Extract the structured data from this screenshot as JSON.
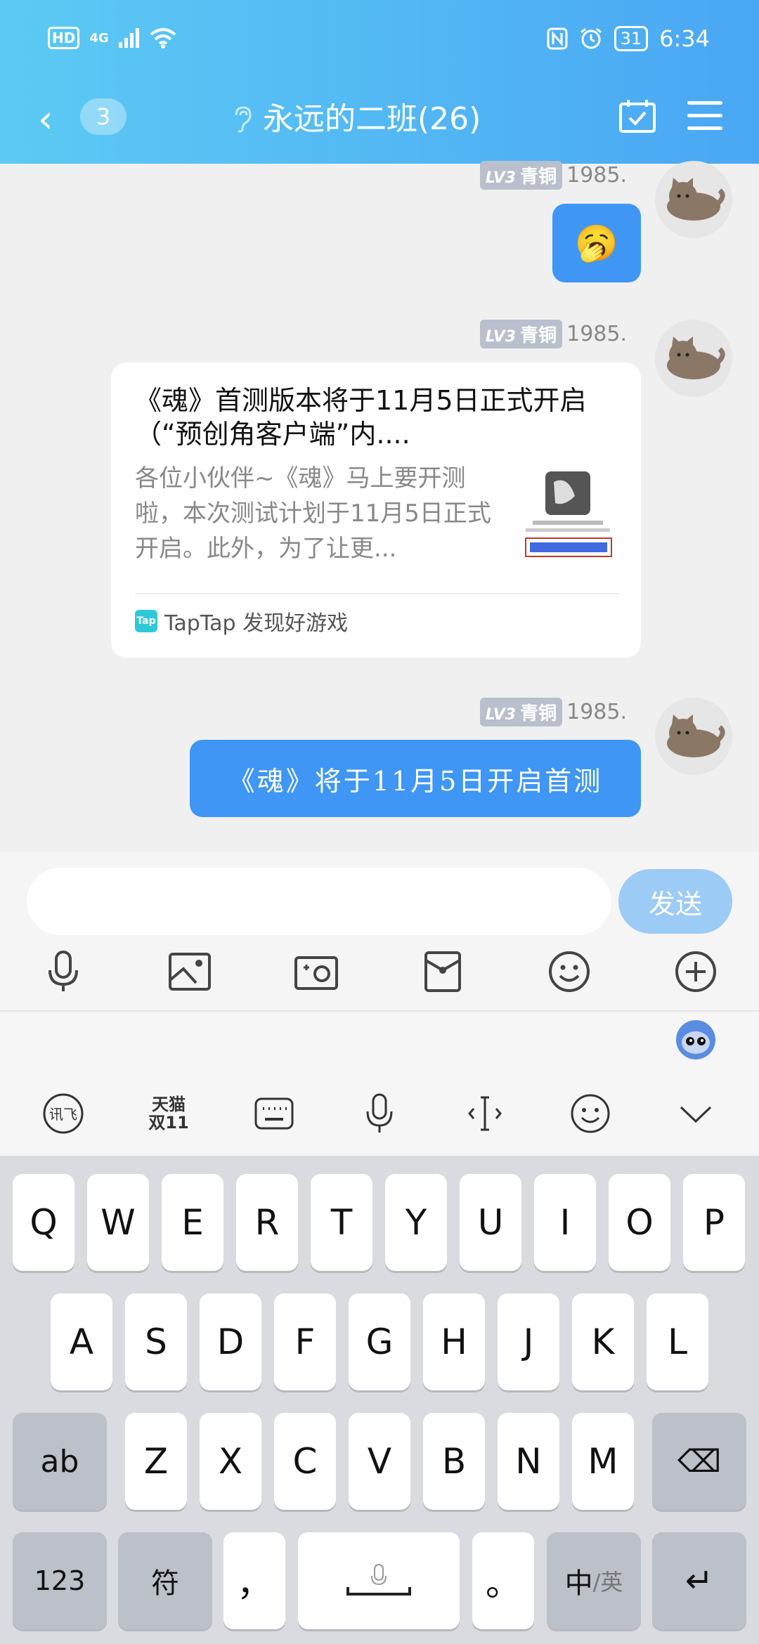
{
  "status_bar": {
    "left_hd": "HD",
    "left_network": "4G",
    "battery": "31",
    "time": "6:34"
  },
  "nav": {
    "back_glyph": "‹",
    "unread_count": "3",
    "title": "永远的二班(26)",
    "icons": [
      "back-icon",
      "ear-icon",
      "calendar-check-icon",
      "menu-icon"
    ]
  },
  "messages": [
    {
      "type": "emoji",
      "level": "LV3",
      "rank": "青铜",
      "username": "1985.",
      "emoji": "🥱"
    },
    {
      "type": "link_card",
      "level": "LV3",
      "rank": "青铜",
      "username": "1985.",
      "title": "《魂》首测版本将于11月5日正式开启（“预创角客户端”内....",
      "description": "各位小伙伴~《魂》马上要开测啦，本次测试计划于11月5日正式开启。此外，为了让更...",
      "source_icon": "Tap",
      "source": "TapTap 发现好游戏"
    },
    {
      "type": "text",
      "level": "LV3",
      "rank": "青铜",
      "username": "1985.",
      "text": "《魂》将于11月5日开启首测"
    }
  ],
  "input": {
    "placeholder": "",
    "send_label": "发送",
    "tools": [
      "microphone-icon",
      "image-icon",
      "camera-icon",
      "red-packet-icon",
      "emoji-icon",
      "plus-icon"
    ]
  },
  "keyboard": {
    "toolbar": {
      "xunfei": "讯飞",
      "tmall_line1": "天猫",
      "tmall_line2": "双11",
      "icons": [
        "xunfei-logo-icon",
        "tmall-icon",
        "keyboard-icon",
        "voice-input-icon",
        "cursor-icon",
        "emoji-icon",
        "collapse-chevron-icon"
      ]
    },
    "row1": [
      "Q",
      "W",
      "E",
      "R",
      "T",
      "Y",
      "U",
      "I",
      "O",
      "P"
    ],
    "row2": [
      "A",
      "S",
      "D",
      "F",
      "G",
      "H",
      "J",
      "K",
      "L"
    ],
    "row3_left": "ab",
    "row3": [
      "Z",
      "X",
      "C",
      "V",
      "B",
      "N",
      "M"
    ],
    "row3_right": "⌫",
    "row4": {
      "num": "123",
      "symbol": "符",
      "comma": "，",
      "space": "",
      "period": "。",
      "lang_main": "中",
      "lang_alt": "/英",
      "enter": "↵"
    }
  }
}
